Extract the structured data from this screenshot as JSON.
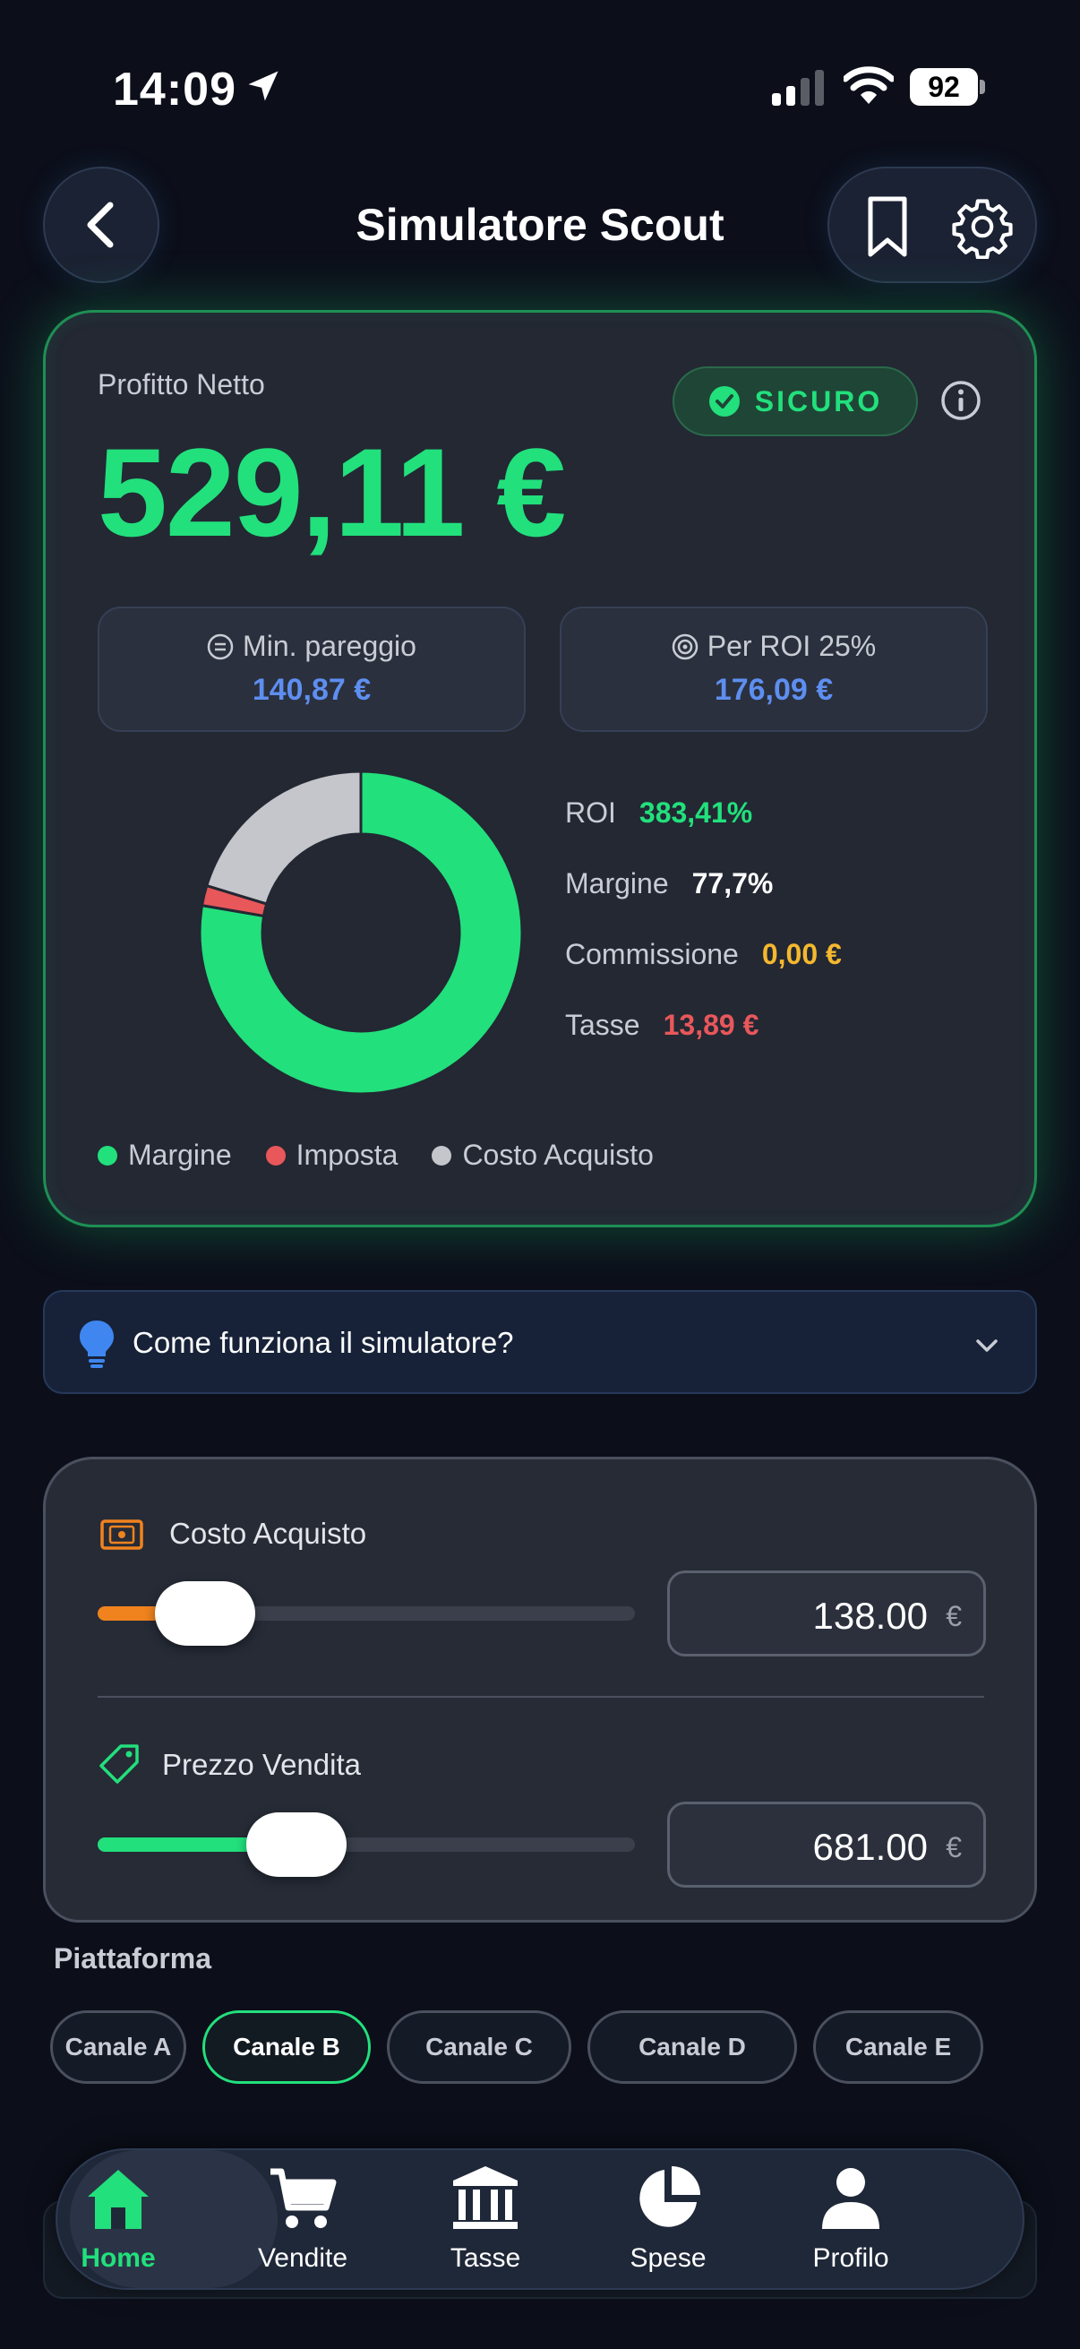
{
  "status": {
    "time": "14:09",
    "battery": "92"
  },
  "header": {
    "title": "Simulatore Scout"
  },
  "summary": {
    "profit_label": "Profitto Netto",
    "profit_value": "529,11 €",
    "badge": "SICURO",
    "breakeven_label": "Min. pareggio",
    "breakeven_value": "140,87 €",
    "roi_target_label": "Per ROI 25%",
    "roi_target_value": "176,09 €",
    "metrics": [
      {
        "label": "ROI",
        "value": "383,41%",
        "color": "#22e07c"
      },
      {
        "label": "Margine",
        "value": "77,7%",
        "color": "#ffffff"
      },
      {
        "label": "Commissione",
        "value": "0,00 €",
        "color": "#f5b82e"
      },
      {
        "label": "Tasse",
        "value": "13,89 €",
        "color": "#e8575a"
      }
    ],
    "legend": [
      {
        "label": "Margine",
        "color": "#22e07c"
      },
      {
        "label": "Imposta",
        "color": "#e8575a"
      },
      {
        "label": "Costo Acquisto",
        "color": "#c4c6cb"
      }
    ]
  },
  "chart_data": {
    "type": "pie",
    "categories": [
      "Margine",
      "Imposta",
      "Costo Acquisto"
    ],
    "values": [
      77.7,
      2.0,
      20.3
    ],
    "colors": [
      "#22e07c",
      "#e8575a",
      "#c4c6cb"
    ]
  },
  "howto": {
    "label": "Come funziona il simulatore?"
  },
  "inputs": {
    "cost": {
      "label": "Costo Acquisto",
      "value": "138.00",
      "unit": "€",
      "level": 0.2,
      "color": "#f0831e"
    },
    "price": {
      "label": "Prezzo Vendita",
      "value": "681.00",
      "unit": "€",
      "level": 0.37,
      "color": "#22e07c"
    }
  },
  "platform": {
    "label": "Piattaforma",
    "options": [
      "Canale A",
      "Canale B",
      "Canale C",
      "Canale D",
      "Canale E"
    ],
    "selected": "Canale B"
  },
  "tabbar": {
    "items": [
      {
        "label": "Home",
        "icon": "home-icon"
      },
      {
        "label": "Vendite",
        "icon": "cart-icon"
      },
      {
        "label": "Tasse",
        "icon": "bank-icon"
      },
      {
        "label": "Spese",
        "icon": "pie-chart-icon"
      },
      {
        "label": "Profilo",
        "icon": "user-icon"
      }
    ],
    "active": "Home"
  }
}
